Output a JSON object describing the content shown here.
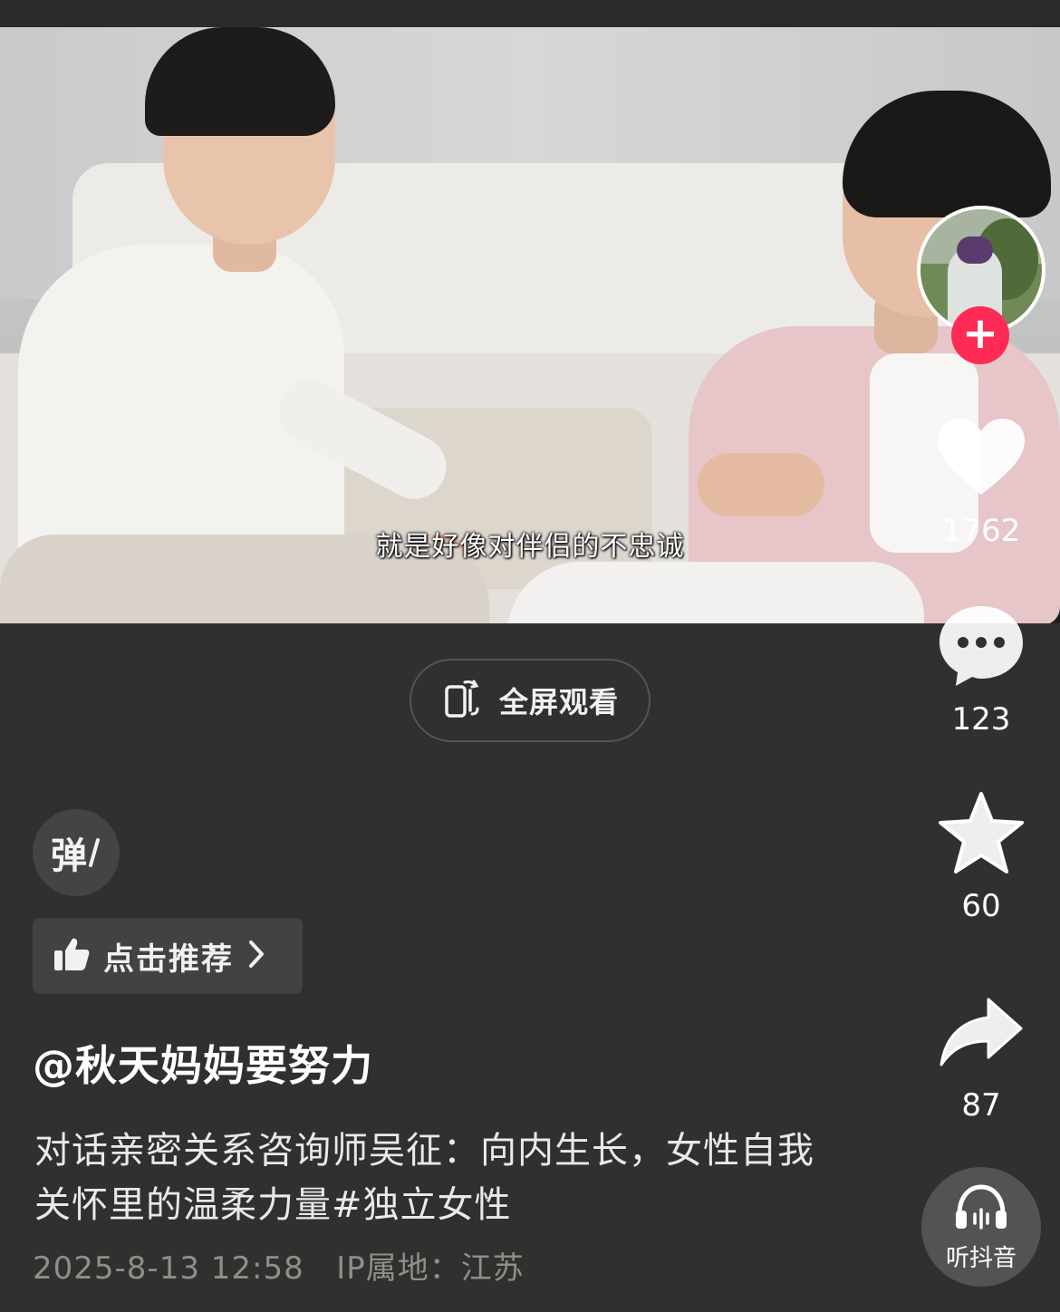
{
  "video": {
    "subtitle": "就是好像对伴侣的不忠诚"
  },
  "fullscreen": {
    "label": "全屏观看",
    "icon": "rotate-phone-icon"
  },
  "actions": {
    "like_count": "1762",
    "comment_count": "123",
    "favorite_count": "60",
    "share_count": "87"
  },
  "danmu": {
    "label": "弹"
  },
  "recommend": {
    "label": "点击推荐",
    "icon": "thumbs-up-icon"
  },
  "post": {
    "author": "@秋天妈妈要努力",
    "description": "对话亲密关系咨询师吴征：向内生长，女性自我关怀里的温柔力量#独立女性",
    "datetime": "2025-8-13 12:58",
    "ip_location": "IP属地：江苏"
  },
  "listen": {
    "label": "听抖音"
  },
  "colors": {
    "background": "#31302e",
    "follow_red": "#fe2c55",
    "meta_gray": "#8f8e8b"
  }
}
